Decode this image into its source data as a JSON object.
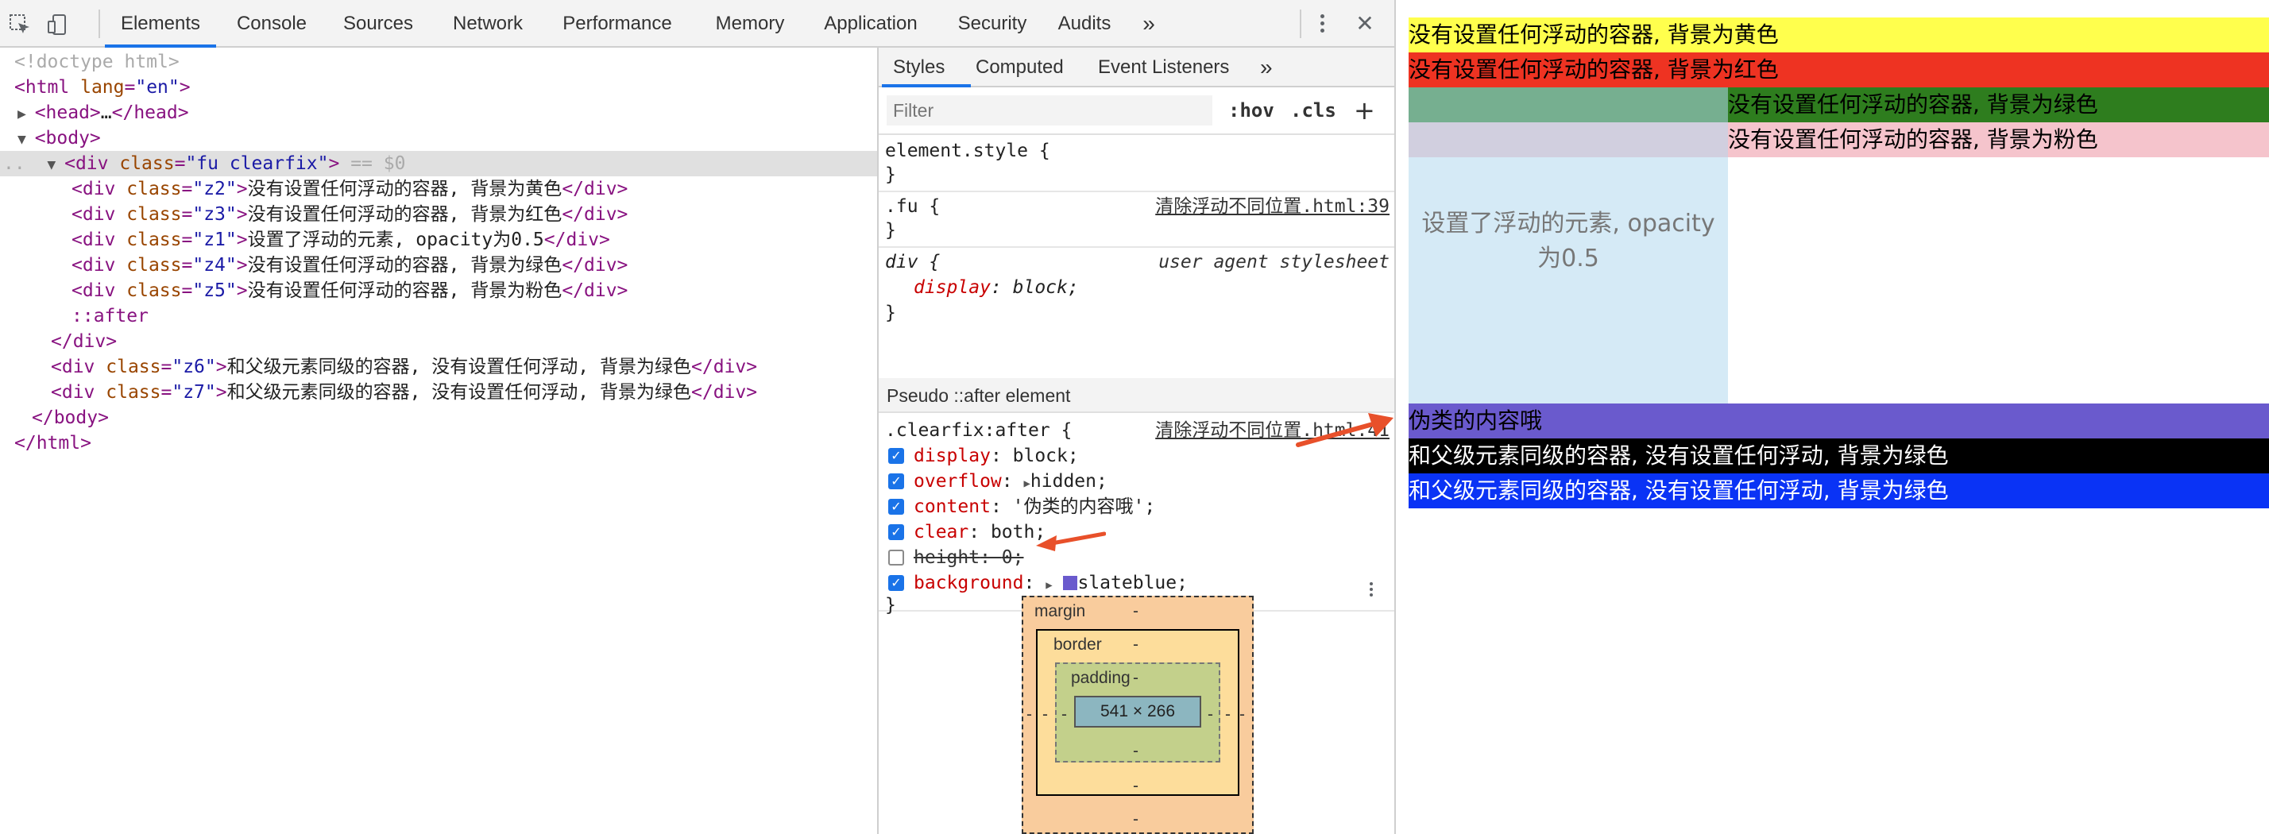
{
  "toolbar": {
    "tabs": [
      "Elements",
      "Console",
      "Sources",
      "Network",
      "Performance",
      "Memory",
      "Application",
      "Security",
      "Audits"
    ],
    "more": "»",
    "close": "✕"
  },
  "dom": {
    "lines": [
      "<!doctype html>",
      "<html lang=\"en\">",
      "<head>…</head>",
      "<body>",
      "<div class=\"fu clearfix\"> == $0",
      "<div class=\"z2\">没有设置任何浮动的容器, 背景为黄色</div>",
      "<div class=\"z3\">没有设置任何浮动的容器, 背景为红色</div>",
      "<div class=\"z1\">设置了浮动的元素, opacity为0.5</div>",
      "<div class=\"z4\">没有设置任何浮动的容器, 背景为绿色</div>",
      "<div class=\"z5\">没有设置任何浮动的容器, 背景为粉色</div>",
      "::after",
      "</div>",
      "<div class=\"z6\">和父级元素同级的容器, 没有设置任何浮动, 背景为绿色</div>",
      "<div class=\"z7\">和父级元素同级的容器, 没有设置任何浮动, 背景为绿色</div>",
      "</body>",
      "</html>"
    ],
    "z_texts": {
      "z2": "没有设置任何浮动的容器, 背景为黄色",
      "z3": "没有设置任何浮动的容器, 背景为红色",
      "z1": "设置了浮动的元素, opacity为0.5",
      "z4": "没有设置任何浮动的容器, 背景为绿色",
      "z5": "没有设置任何浮动的容器, 背景为粉色",
      "z6": "和父级元素同级的容器, 没有设置任何浮动, 背景为绿色",
      "z7": "和父级元素同级的容器, 没有设置任何浮动, 背景为绿色"
    }
  },
  "styles": {
    "subtabs": [
      "Styles",
      "Computed",
      "Event Listeners"
    ],
    "more": "»",
    "filter_placeholder": "Filter",
    "hov": ":hov",
    "cls": ".cls",
    "add": "+",
    "element_style": "element.style {",
    "close_brace": "}",
    "fu_selector": ".fu {",
    "fu_source": "清除浮动不同位置.html:39",
    "div_selector": "div {",
    "ua_label": "user agent stylesheet",
    "div_decl": "display: block;",
    "pseudo_header": "Pseudo ::after element",
    "after_selector": ".clearfix:after {",
    "after_source": "清除浮动不同位置.html:41",
    "after_props": [
      {
        "name": "display",
        "value": "block;",
        "checked": true
      },
      {
        "name": "overflow",
        "value": "hidden;",
        "checked": true
      },
      {
        "name": "content",
        "value": "'伪类的内容哦';",
        "checked": true
      },
      {
        "name": "clear",
        "value": "both;",
        "checked": true
      },
      {
        "name": "height",
        "value": "0;",
        "checked": false
      },
      {
        "name": "background",
        "value": "slateblue;",
        "checked": true
      }
    ],
    "swatch_color": "#6a5acd"
  },
  "boxmodel": {
    "margin": "margin",
    "border": "border",
    "padding": "padding",
    "content": "541 × 266",
    "dash": "-"
  },
  "page": {
    "yellow": "没有设置任何浮动的容器, 背景为黄色",
    "red": "没有设置任何浮动的容器, 背景为红色",
    "green": "没有设置任何浮动的容器, 背景为绿色",
    "pink": "没有设置任何浮动的容器, 背景为粉色",
    "float_text": "设置了浮动的元素, opacity为0.5",
    "pseudo": "伪类的内容哦",
    "black": "和父级元素同级的容器, 没有设置任何浮动, 背景为绿色",
    "blue": "和父级元素同级的容器, 没有设置任何浮动, 背景为绿色"
  },
  "colors": {
    "yellow": "#ffff4d",
    "red": "#ee3322",
    "green": "#2e7d1e",
    "pink": "#f5c4cc",
    "float_bg": "#b3d9ee",
    "slateblue": "#6a5acd",
    "black": "#000000",
    "blue": "#0a33f5",
    "arrow": "#e8502a",
    "accent": "#1a73e8"
  }
}
